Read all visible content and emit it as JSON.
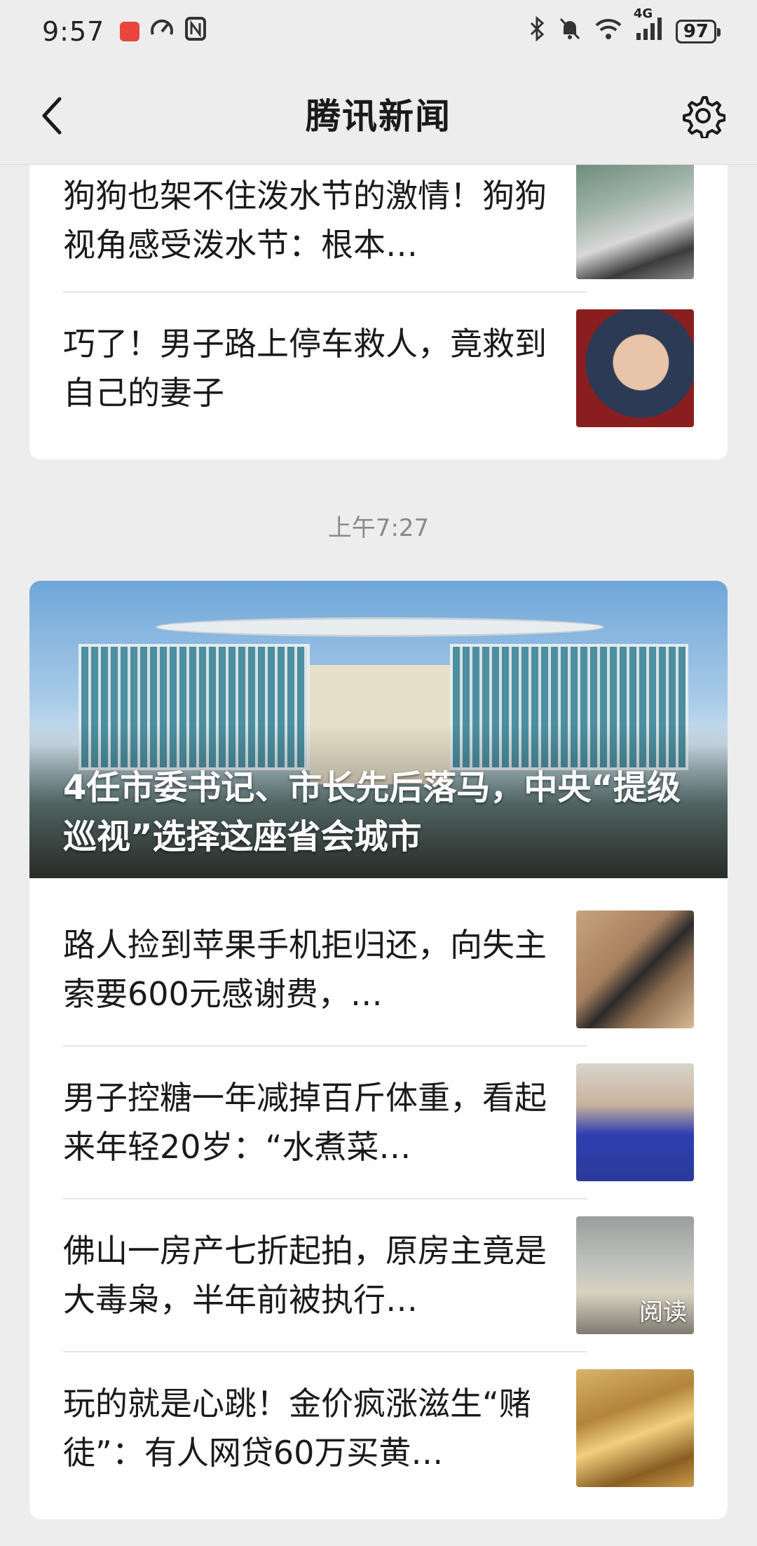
{
  "status_bar": {
    "time": "9:57",
    "network": "4G",
    "battery": "97",
    "icons": [
      "app-badge-icon",
      "speed-gauge-icon",
      "nfc-icon",
      "bluetooth-icon",
      "mute-bell-icon",
      "wifi-icon",
      "signal-icon",
      "battery-icon"
    ]
  },
  "nav": {
    "title": "腾讯新闻",
    "back_icon": "chevron-left-icon",
    "settings_icon": "gear-icon"
  },
  "top_card": {
    "items": [
      {
        "title": "狗狗也架不住泼水节的激情！狗狗视角感受泼水节：根本…",
        "thumb": "dog"
      },
      {
        "title": "巧了！男子路上停车救人，竟救到自己的妻子",
        "thumb": "man"
      }
    ]
  },
  "timestamp": "上午7:27",
  "bottom_card": {
    "hero": {
      "title": "4任市委书记、市长先后落马，中央“提级巡视”选择这座省会城市"
    },
    "items": [
      {
        "title": "路人捡到苹果手机拒归还，向失主索要600元感谢费，…",
        "thumb": "phone"
      },
      {
        "title": "男子控糖一年减掉百斤体重，看起来年轻20岁：“水煮菜…",
        "thumb": "young-man"
      },
      {
        "title": "佛山一房产七折起拍，原房主竟是大毒枭，半年前被执行…",
        "thumb": "car",
        "tag": "阅读"
      },
      {
        "title": "玩的就是心跳！金价疯涨滋生“赌徒”：有人网贷60万买黄…",
        "thumb": "gold"
      }
    ]
  }
}
